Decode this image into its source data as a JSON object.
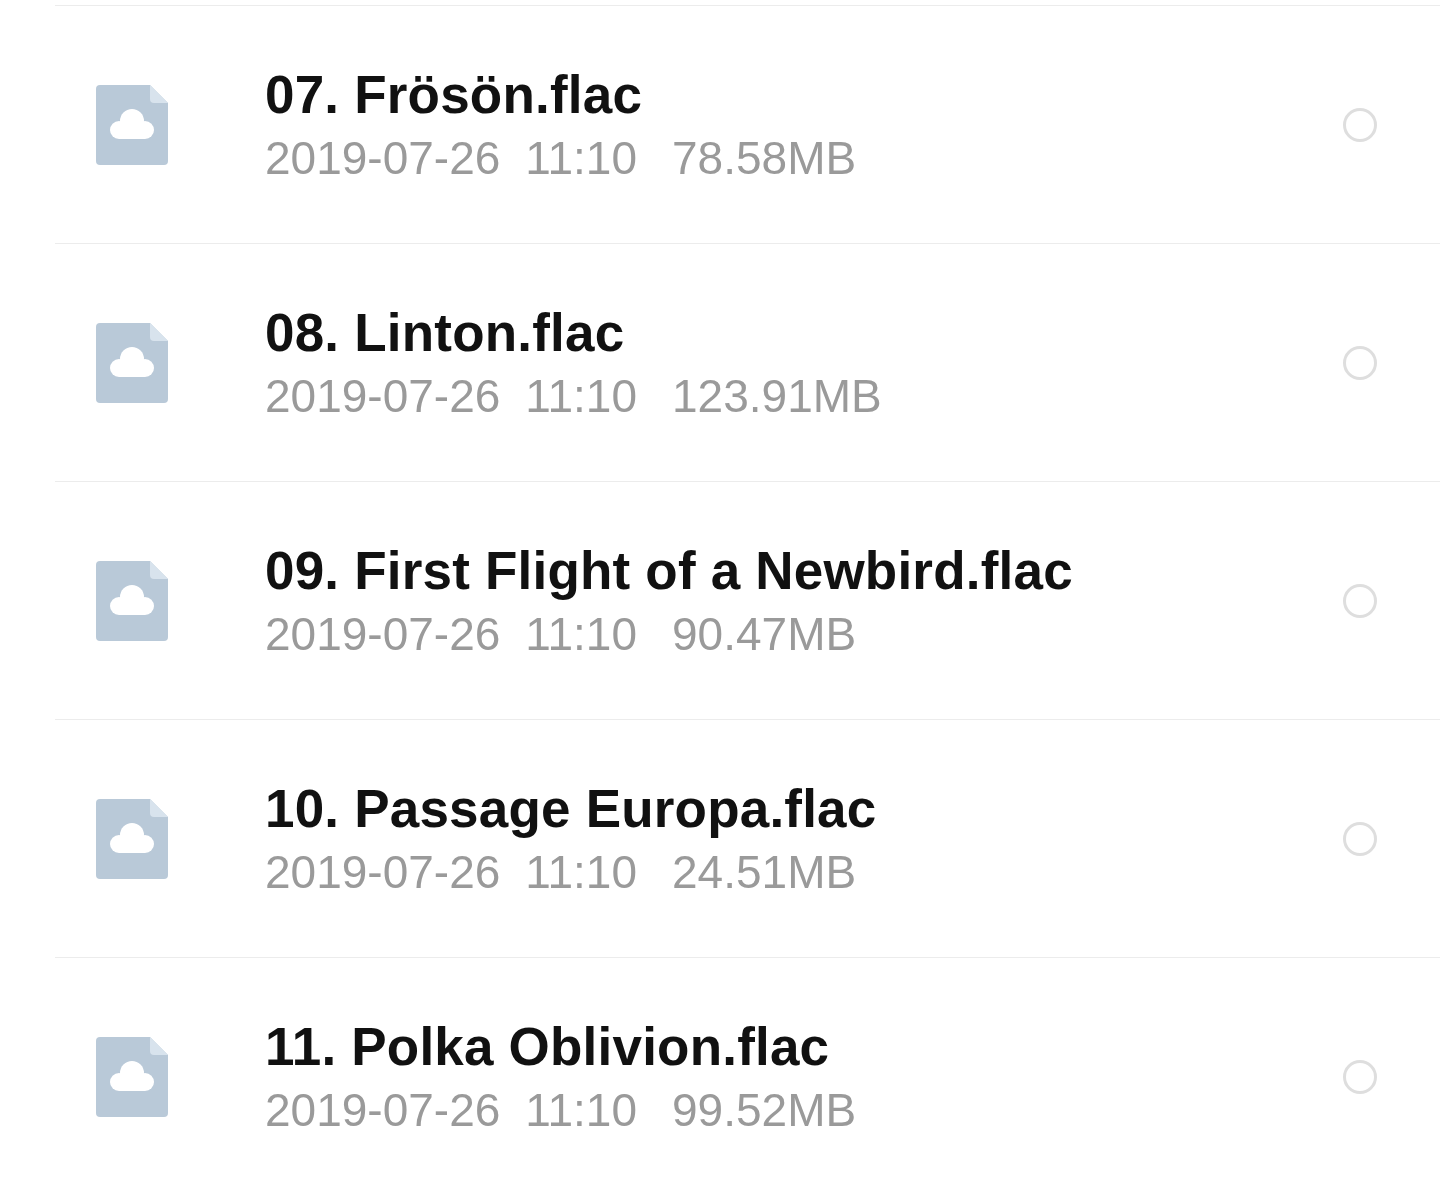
{
  "files": [
    {
      "name": "07. Frösön.flac",
      "date": "2019-07-26",
      "time": "11:10",
      "size": "78.58MB",
      "selected": false
    },
    {
      "name": "08. Linton.flac",
      "date": "2019-07-26",
      "time": "11:10",
      "size": "123.91MB",
      "selected": false
    },
    {
      "name": "09. First Flight of a Newbird.flac",
      "date": "2019-07-26",
      "time": "11:10",
      "size": "90.47MB",
      "selected": false
    },
    {
      "name": "10. Passage Europa.flac",
      "date": "2019-07-26",
      "time": "11:10",
      "size": "24.51MB",
      "selected": false
    },
    {
      "name": "11. Polka Oblivion.flac",
      "date": "2019-07-26",
      "time": "11:10",
      "size": "99.52MB",
      "selected": false
    }
  ]
}
